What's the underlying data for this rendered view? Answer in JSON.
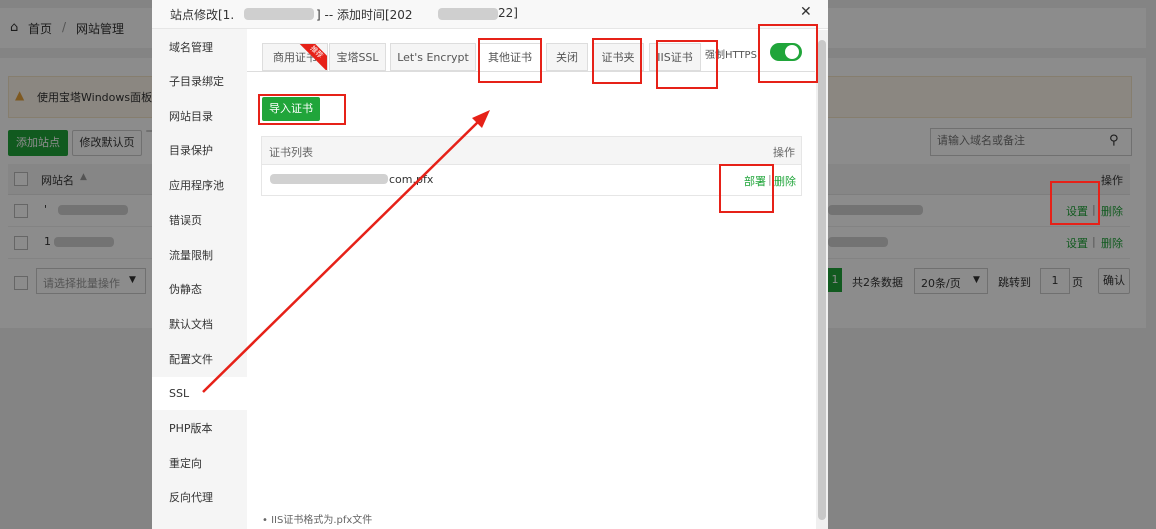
{
  "background": {
    "breadcrumb": {
      "home": "首页",
      "separator": "/",
      "current": "网站管理"
    },
    "notice": "使用宝塔Windows面板创",
    "toolbar": {
      "add_site": "添加站点",
      "edit_default": "修改默认页"
    },
    "search_placeholder": "请输入域名或备注",
    "table": {
      "col_site": "网站名",
      "col_op": "操作",
      "rows": [
        {
          "name": "'",
          "set": "设置",
          "sep": "|",
          "del": "删除"
        },
        {
          "name": "1",
          "set": "设置",
          "sep": "|",
          "del": "删除"
        }
      ]
    },
    "bulk_placeholder": "请选择批量操作",
    "pagination": {
      "page_btn": "1",
      "total": "共2条数据",
      "per_page": "20条/页",
      "goto": "跳转到",
      "page_input": "1",
      "page_unit": "页",
      "confirm": "确认"
    }
  },
  "modal": {
    "title_prefix": "站点修改[1.",
    "title_mid": "] -- 添加时间[202",
    "title_suffix": "22]",
    "close": "✕",
    "sidebar": [
      "域名管理",
      "子目录绑定",
      "网站目录",
      "目录保护",
      "应用程序池",
      "错误页",
      "流量限制",
      "伪静态",
      "默认文档",
      "配置文件",
      "SSL",
      "PHP版本",
      "重定向",
      "反向代理"
    ],
    "active_sidebar": "SSL",
    "tabs": [
      "商用证书",
      "宝塔SSL",
      "Let's Encrypt",
      "其他证书",
      "关闭",
      "证书夹",
      "IIS证书"
    ],
    "ribbon": "推荐",
    "force_https_label": "强制HTTPS",
    "force_https_on": true,
    "import_button": "导入证书",
    "cert_table": {
      "header": "证书列表",
      "op_header": "操作",
      "row_name": "com.pfx",
      "deploy": "部署",
      "sep": "|",
      "delete": "删除"
    },
    "note": "IIS证书格式为.pfx文件"
  },
  "colors": {
    "accent": "#20a53a",
    "highlight": "#e62118"
  }
}
